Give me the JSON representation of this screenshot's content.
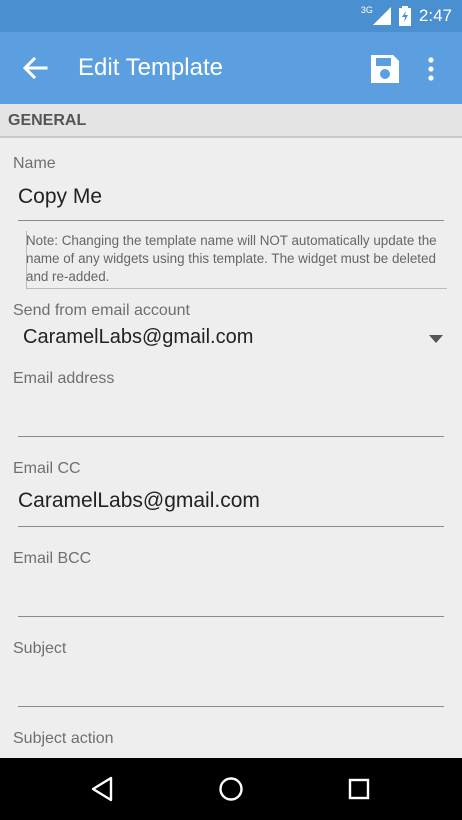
{
  "status_bar": {
    "network": "3G",
    "time": "2:47"
  },
  "app_bar": {
    "title": "Edit Template",
    "back_icon": "arrow-back-icon",
    "save_icon": "save-icon",
    "more_icon": "more-vert-icon"
  },
  "section": {
    "title": "GENERAL"
  },
  "form": {
    "name": {
      "label": "Name",
      "value": "Copy Me"
    },
    "note": "Note: Changing the template name will NOT automatically update the name of any widgets using this template. The widget must be deleted and re-added.",
    "send_from": {
      "label": "Send from email account",
      "value": "CaramelLabs@gmail.com"
    },
    "email_address": {
      "label": "Email address",
      "value": ""
    },
    "email_cc": {
      "label": "Email CC",
      "value": "CaramelLabs@gmail.com"
    },
    "email_bcc": {
      "label": "Email BCC",
      "value": ""
    },
    "subject": {
      "label": "Subject",
      "value": ""
    },
    "subject_action": {
      "label": "Subject action"
    }
  },
  "nav_bar": {
    "back": "back-triangle-icon",
    "home": "home-circle-icon",
    "recents": "recents-square-icon"
  },
  "colors": {
    "status_bar": "#4a8fcf",
    "app_bar": "#5b9fe0",
    "background": "#eeeeee"
  }
}
